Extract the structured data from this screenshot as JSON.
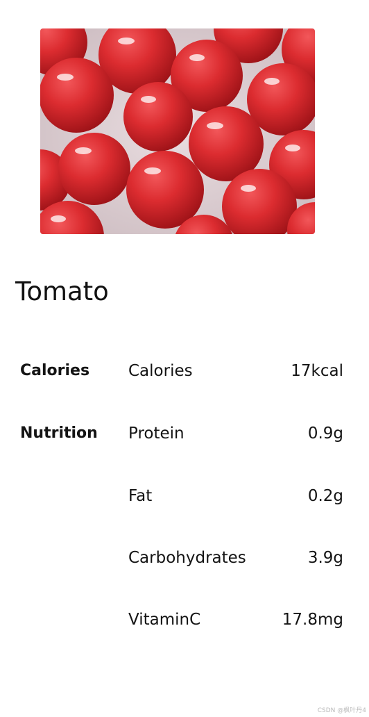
{
  "food": {
    "image_icon": "tomato-photo",
    "name": "Tomato"
  },
  "nutrition": {
    "rows": [
      {
        "category": "Calories",
        "name": "Calories",
        "value": "17kcal"
      },
      {
        "category": "Nutrition",
        "name": "Protein",
        "value": "0.9g"
      },
      {
        "category": "",
        "name": "Fat",
        "value": "0.2g"
      },
      {
        "category": "",
        "name": "Carbohydrates",
        "value": "3.9g"
      },
      {
        "category": "",
        "name": "VitaminC",
        "value": "17.8mg"
      }
    ]
  },
  "watermark": "CSDN @枫叶丹4",
  "colors": {
    "background": "#ffffff",
    "text": "#141414",
    "tomato_red": "#d8262b"
  }
}
